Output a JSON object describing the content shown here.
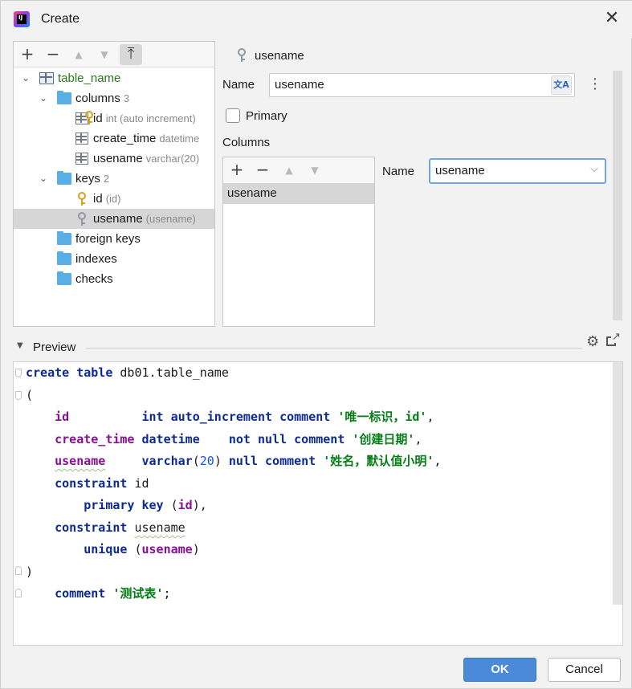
{
  "window": {
    "title": "Create",
    "close_glyph": "✕"
  },
  "tree": {
    "toolbar": {
      "add": "+",
      "remove": "−",
      "up": "▲",
      "down": "▼",
      "pin": "⤒"
    },
    "root": {
      "label": "table_name",
      "icon": "table-icon"
    },
    "nodes": [
      {
        "label": "columns",
        "hint": "3",
        "icon": "folder-icon"
      },
      {
        "label": "id",
        "hint": "int (auto increment)",
        "icon": "primary-key-column-icon"
      },
      {
        "label": "create_time",
        "hint": "datetime",
        "icon": "column-icon"
      },
      {
        "label": "usename",
        "hint": "varchar(20)",
        "icon": "column-icon"
      },
      {
        "label": "keys",
        "hint": "2",
        "icon": "folder-icon"
      },
      {
        "label": "id",
        "hint": "(id)",
        "icon": "primary-key-icon"
      },
      {
        "label": "usename",
        "hint": "(usename)",
        "icon": "unique-key-icon"
      },
      {
        "label": "foreign keys",
        "icon": "folder-icon"
      },
      {
        "label": "indexes",
        "icon": "folder-icon"
      },
      {
        "label": "checks",
        "icon": "folder-icon"
      }
    ]
  },
  "properties": {
    "header": "usename",
    "name_label": "Name",
    "name_value": "usename",
    "primary_label": "Primary",
    "primary_checked": false,
    "columns_label": "Columns",
    "columns_items": [
      "usename"
    ],
    "column_name_label": "Name",
    "column_name_value": "usename"
  },
  "preview": {
    "label": "Preview",
    "code": {
      "l1": {
        "kw1": "create",
        "kw2": "table",
        "name": "db01.table_name"
      },
      "l2": "(",
      "l3": {
        "field": "id",
        "type": "int",
        "extra": "auto_increment",
        "kw": "comment",
        "str": "'唯一标识，id'",
        "end": ","
      },
      "l4": {
        "field": "create_time",
        "type": "datetime",
        "kw1": "not",
        "kw2": "null",
        "kw3": "comment",
        "str": "'创建日期'",
        "end": ","
      },
      "l5": {
        "field": "usename",
        "type": "varchar",
        "open": "(",
        "num": "20",
        "close": ")",
        "kw1": "null",
        "kw2": "comment",
        "str": "'姓名，默认值小明'",
        "end": ","
      },
      "l6": {
        "kw": "constraint",
        "name": "id"
      },
      "l7": {
        "kw1": "primary",
        "kw2": "key",
        "open": "(",
        "field": "id",
        "close": "),"
      },
      "l8": {
        "kw": "constraint",
        "name": "usename"
      },
      "l9": {
        "kw": "unique",
        "open": "(",
        "field": "usename",
        "close": ")"
      },
      "l10": ")",
      "l11": {
        "kw": "comment",
        "str": "'测试表'",
        "end": ";"
      }
    }
  },
  "buttons": {
    "ok": "OK",
    "cancel": "Cancel"
  },
  "colors": {
    "accent": "#4a8ad9",
    "keyword": "#0c2a91",
    "field": "#871094",
    "string": "#067d17",
    "number": "#1750eb",
    "tree_root": "#2a7a1a"
  }
}
